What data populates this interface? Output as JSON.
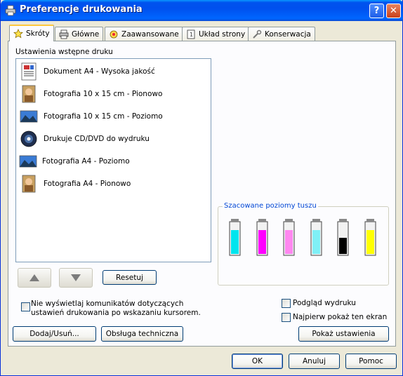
{
  "window": {
    "title": "Preferencje drukowania"
  },
  "tabs": [
    {
      "label": "Skróty",
      "icon": "star-icon",
      "active": true
    },
    {
      "label": "Główne",
      "icon": "printer-icon",
      "active": false
    },
    {
      "label": "Zaawansowane",
      "icon": "advanced-icon",
      "active": false
    },
    {
      "label": "Układ strony",
      "icon": "page-layout-icon",
      "active": false
    },
    {
      "label": "Konserwacja",
      "icon": "wrench-icon",
      "active": false
    }
  ],
  "presets": {
    "label": "Ustawienia wstępne druku",
    "items": [
      {
        "label": "Dokument A4 - Wysoka jakość",
        "icon": "document-icon"
      },
      {
        "label": "Fotografia 10 x 15 cm - Pionowo",
        "icon": "portrait-photo-icon"
      },
      {
        "label": "Fotografia 10 x 15 cm - Poziomo",
        "icon": "landscape-photo-icon"
      },
      {
        "label": "Drukuje CD/DVD do wydruku",
        "icon": "cd-icon"
      },
      {
        "label": "Fotografia A4 - Poziomo",
        "icon": "landscape-photo-icon"
      },
      {
        "label": "Fotografia A4 - Pionowo",
        "icon": "portrait-photo-icon"
      }
    ]
  },
  "buttons": {
    "reset": "Resetuj",
    "add_remove": "Dodaj/Usuń...",
    "support": "Obsługa techniczna",
    "show_settings": "Pokaż ustawienia",
    "ok": "OK",
    "cancel": "Anuluj",
    "help": "Pomoc"
  },
  "checkboxes": {
    "no_messages": "Nie wyświetlaj komunikatów dotyczących ustawień drukowania po wskazaniu kursorem.",
    "preview": "Podgląd wydruku",
    "show_first": "Najpierw pokaż ten ekran"
  },
  "ink": {
    "label": "Szacowane poziomy tuszu",
    "cartridges": [
      {
        "color": "#00e5ee",
        "level": 0.78
      },
      {
        "color": "#ff00ff",
        "level": 0.78
      },
      {
        "color": "#ff88f0",
        "level": 0.78
      },
      {
        "color": "#7ff0f6",
        "level": 0.78
      },
      {
        "color": "#000000",
        "level": 0.52
      },
      {
        "color": "#ffff00",
        "level": 0.78
      }
    ]
  },
  "colors": {
    "title_bar": "#0053ee",
    "accent_tab": "#ffc83c",
    "group_legend": "#0046d5"
  }
}
